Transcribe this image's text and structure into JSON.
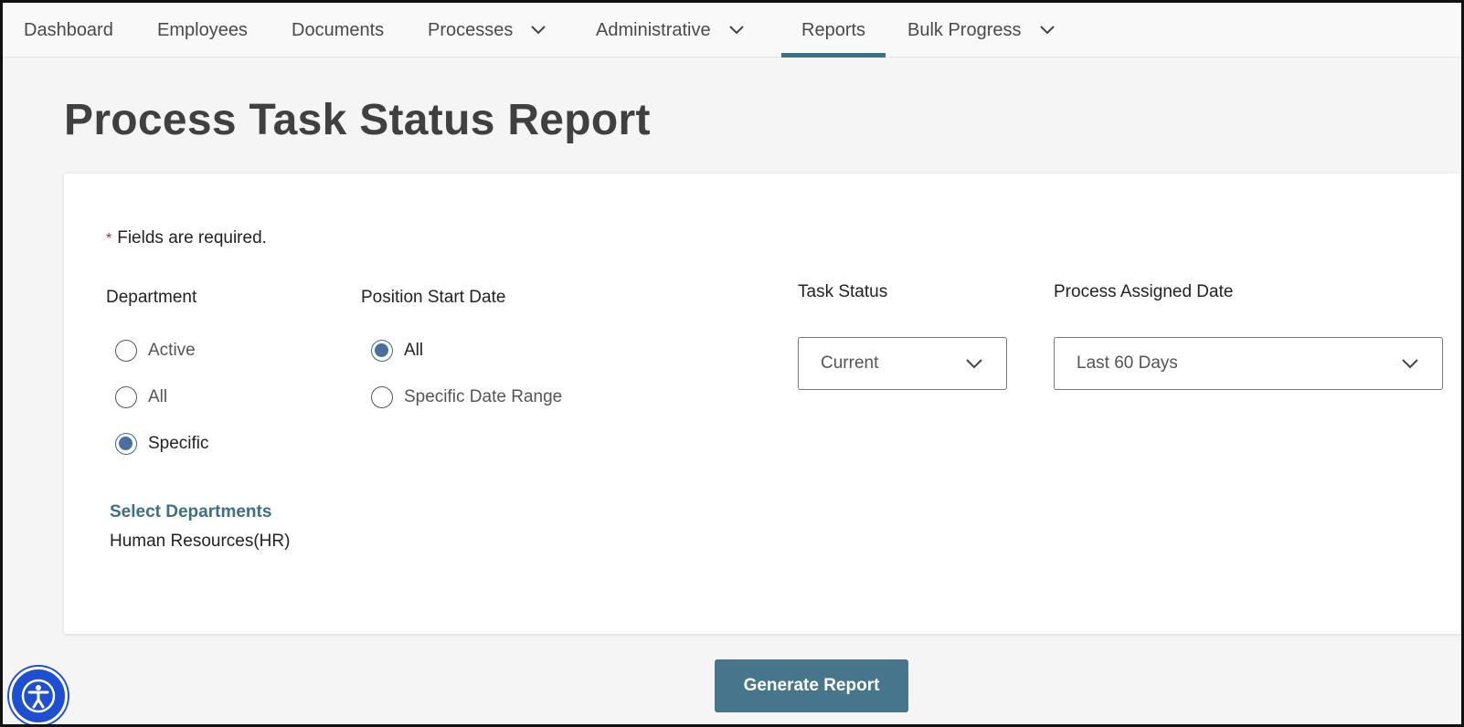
{
  "nav": {
    "items": [
      {
        "label": "Dashboard",
        "has_dropdown": false,
        "active": false
      },
      {
        "label": "Employees",
        "has_dropdown": false,
        "active": false
      },
      {
        "label": "Documents",
        "has_dropdown": false,
        "active": false
      },
      {
        "label": "Processes",
        "has_dropdown": true,
        "active": false
      },
      {
        "label": "Administrative",
        "has_dropdown": true,
        "active": false
      },
      {
        "label": "Reports",
        "has_dropdown": false,
        "active": true
      },
      {
        "label": "Bulk Progress",
        "has_dropdown": true,
        "active": false
      }
    ]
  },
  "page": {
    "title": "Process Task Status Report"
  },
  "form": {
    "required_star": "*",
    "required_note": "Fields are required.",
    "department": {
      "label": "Department",
      "options": [
        "Active",
        "All",
        "Specific"
      ],
      "selected": "Specific",
      "select_link": "Select Departments",
      "selected_value": "Human Resources(HR)"
    },
    "position_start_date": {
      "label": "Position Start Date",
      "options": [
        "All",
        "Specific Date Range"
      ],
      "selected": "All"
    },
    "task_status": {
      "label": "Task Status",
      "value": "Current"
    },
    "process_assigned_date": {
      "label": "Process Assigned Date",
      "value": "Last 60 Days"
    },
    "generate_button": "Generate Report"
  },
  "colors": {
    "accent": "#3d6f85",
    "button": "#47758c",
    "radio_checked": "#4a6e9e",
    "required": "#c62828",
    "accessibility": "#1f4fd1"
  },
  "icons": {
    "dropdown": "chevron-down-icon",
    "accessibility": "accessibility-icon"
  }
}
